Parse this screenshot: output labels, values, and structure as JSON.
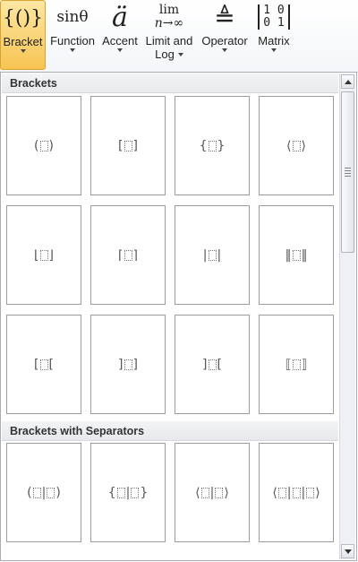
{
  "ribbon": {
    "buttons": [
      {
        "icon": "{()}",
        "label": "Bracket",
        "active": true
      },
      {
        "icon": "sinθ",
        "label": "Function"
      },
      {
        "icon": "ä",
        "label": "Accent"
      },
      {
        "icon_top": "lim",
        "icon_bottom": "n→∞",
        "label_line1": "Limit and",
        "label_line2": "Log"
      },
      {
        "icon": "≜",
        "label": "Operator"
      },
      {
        "icon_row1": "1 0",
        "icon_row2": "0 1",
        "label": "Matrix"
      }
    ]
  },
  "gallery": {
    "sections": [
      {
        "title": "Brackets"
      },
      {
        "title": "Brackets with Separators"
      }
    ],
    "tiles": [
      {
        "left": "(",
        "mid": "",
        "right": ")"
      },
      {
        "left": "[",
        "mid": "",
        "right": "]"
      },
      {
        "left": "{",
        "mid": "",
        "right": "}"
      },
      {
        "left": "⟨",
        "mid": "",
        "right": "⟩"
      },
      {
        "left": "⌊",
        "mid": "",
        "right": "⌋"
      },
      {
        "left": "⌈",
        "mid": "",
        "right": "⌉"
      },
      {
        "left": "|",
        "mid": "",
        "right": "|"
      },
      {
        "left": "‖",
        "mid": "",
        "right": "‖"
      },
      {
        "left": "[",
        "mid": "",
        "right": "["
      },
      {
        "left": "]",
        "mid": "",
        "right": "]"
      },
      {
        "left": "]",
        "mid": "",
        "right": "["
      },
      {
        "left": "⟦",
        "mid": "",
        "right": "⟧"
      },
      {
        "left": "(",
        "mid": "|",
        "right": ")"
      },
      {
        "left": "{",
        "mid": "|",
        "right": "}"
      },
      {
        "left": "⟨",
        "mid": "|",
        "right": "⟩"
      },
      {
        "left": "⟨",
        "mid": "|",
        "right": "⟩",
        "triple": true
      }
    ]
  }
}
